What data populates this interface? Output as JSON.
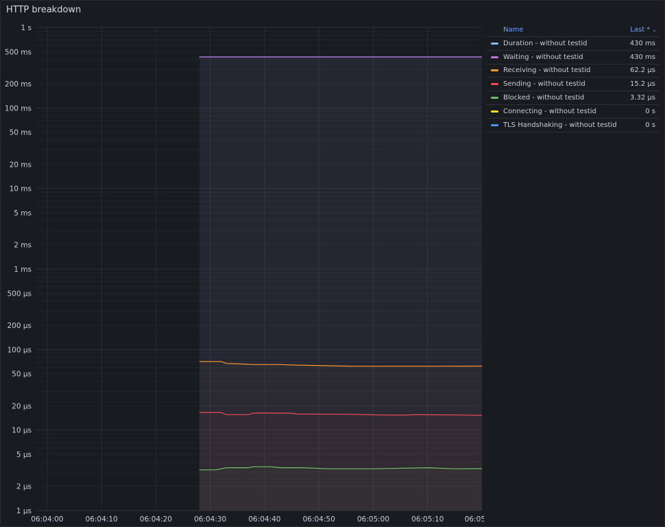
{
  "panel": {
    "title": "HTTP breakdown"
  },
  "legend": {
    "name_header": "Name",
    "last_header": "Last *",
    "sort_icon": "chevron-down-icon"
  },
  "colors": {
    "duration": "#8ab8ff",
    "waiting": "#b877d9",
    "receiving": "#ff9830",
    "sending": "#f2495c",
    "blocked": "#73bf69",
    "connecting": "#fade2a",
    "tls": "#5794f2"
  },
  "chart_data": {
    "type": "line",
    "y_scale": "log",
    "ylim_seconds": [
      1e-06,
      1
    ],
    "y_ticks": [
      {
        "value": 1,
        "label": "1 s"
      },
      {
        "value": 0.5,
        "label": "500 ms"
      },
      {
        "value": 0.2,
        "label": "200 ms"
      },
      {
        "value": 0.1,
        "label": "100 ms"
      },
      {
        "value": 0.05,
        "label": "50 ms"
      },
      {
        "value": 0.02,
        "label": "20 ms"
      },
      {
        "value": 0.01,
        "label": "10 ms"
      },
      {
        "value": 0.005,
        "label": "5 ms"
      },
      {
        "value": 0.002,
        "label": "2 ms"
      },
      {
        "value": 0.001,
        "label": "1 ms"
      },
      {
        "value": 0.0005,
        "label": "500 µs"
      },
      {
        "value": 0.0002,
        "label": "200 µs"
      },
      {
        "value": 0.0001,
        "label": "100 µs"
      },
      {
        "value": 5e-05,
        "label": "50 µs"
      },
      {
        "value": 2e-05,
        "label": "20 µs"
      },
      {
        "value": 1e-05,
        "label": "10 µs"
      },
      {
        "value": 5e-06,
        "label": "5 µs"
      },
      {
        "value": 2e-06,
        "label": "2 µs"
      },
      {
        "value": 1e-06,
        "label": "1 µs"
      }
    ],
    "x_ticks": [
      "06:04:00",
      "06:04:10",
      "06:04:20",
      "06:04:30",
      "06:04:40",
      "06:04:50",
      "06:05:00",
      "06:05:10",
      "06:05"
    ],
    "x_range": [
      "06:03:58",
      "06:05:20"
    ],
    "grid": true,
    "legend_position": "right",
    "series": [
      {
        "name": "Duration - without testid",
        "color_key": "duration",
        "last": "430 ms",
        "points": [
          [
            "06:04:28",
            0.43
          ],
          [
            "06:04:40",
            0.43
          ],
          [
            "06:04:50",
            0.43
          ],
          [
            "06:05:00",
            0.43
          ],
          [
            "06:05:10",
            0.43
          ],
          [
            "06:05:20",
            0.43
          ]
        ]
      },
      {
        "name": "Waiting - without testid",
        "color_key": "waiting",
        "last": "430 ms",
        "points": [
          [
            "06:04:28",
            0.43
          ],
          [
            "06:04:40",
            0.43
          ],
          [
            "06:04:50",
            0.43
          ],
          [
            "06:05:00",
            0.43
          ],
          [
            "06:05:10",
            0.43
          ],
          [
            "06:05:20",
            0.43
          ]
        ]
      },
      {
        "name": "Receiving - without testid",
        "color_key": "receiving",
        "last": "62.2 µs",
        "points": [
          [
            "06:04:28",
            7.1e-05
          ],
          [
            "06:04:32",
            7.1e-05
          ],
          [
            "06:04:33",
            6.7e-05
          ],
          [
            "06:04:36",
            6.6e-05
          ],
          [
            "06:04:38",
            6.5e-05
          ],
          [
            "06:04:43",
            6.5e-05
          ],
          [
            "06:04:46",
            6.4e-05
          ],
          [
            "06:04:51",
            6.3e-05
          ],
          [
            "06:04:56",
            6.2e-05
          ],
          [
            "06:05:05",
            6.2e-05
          ],
          [
            "06:05:12",
            6.2e-05
          ],
          [
            "06:05:20",
            6.22e-05
          ]
        ]
      },
      {
        "name": "Sending - without testid",
        "color_key": "sending",
        "last": "15.2 µs",
        "points": [
          [
            "06:04:28",
            1.65e-05
          ],
          [
            "06:04:32",
            1.65e-05
          ],
          [
            "06:04:33",
            1.55e-05
          ],
          [
            "06:04:37",
            1.55e-05
          ],
          [
            "06:04:38",
            1.63e-05
          ],
          [
            "06:04:45",
            1.62e-05
          ],
          [
            "06:04:46",
            1.58e-05
          ],
          [
            "06:04:55",
            1.57e-05
          ],
          [
            "06:05:01",
            1.54e-05
          ],
          [
            "06:05:05",
            1.53e-05
          ],
          [
            "06:05:08",
            1.55e-05
          ],
          [
            "06:05:15",
            1.54e-05
          ],
          [
            "06:05:20",
            1.52e-05
          ]
        ]
      },
      {
        "name": "Blocked - without testid",
        "color_key": "blocked",
        "last": "3.32 µs",
        "points": [
          [
            "06:04:28",
            3.2e-06
          ],
          [
            "06:04:31",
            3.2e-06
          ],
          [
            "06:04:33",
            3.4e-06
          ],
          [
            "06:04:37",
            3.4e-06
          ],
          [
            "06:04:38",
            3.5e-06
          ],
          [
            "06:04:41",
            3.5e-06
          ],
          [
            "06:04:43",
            3.4e-06
          ],
          [
            "06:04:47",
            3.4e-06
          ],
          [
            "06:04:52",
            3.3e-06
          ],
          [
            "06:05:00",
            3.3e-06
          ],
          [
            "06:05:10",
            3.4e-06
          ],
          [
            "06:05:15",
            3.3e-06
          ],
          [
            "06:05:20",
            3.32e-06
          ]
        ]
      },
      {
        "name": "Connecting - without testid",
        "color_key": "connecting",
        "last": "0 s",
        "points": []
      },
      {
        "name": "TLS Handshaking - without testid",
        "color_key": "tls",
        "last": "0 s",
        "points": []
      }
    ]
  }
}
